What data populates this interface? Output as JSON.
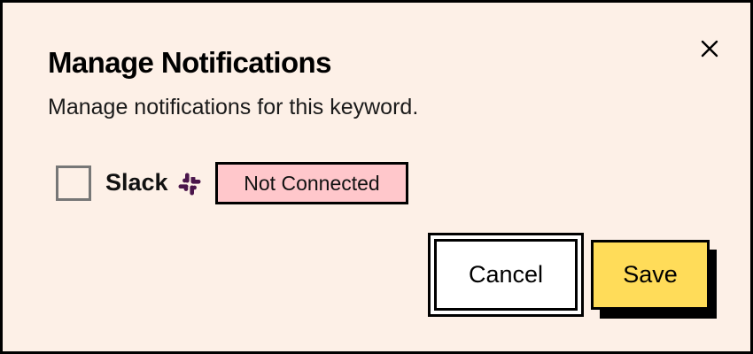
{
  "dialog": {
    "title": "Manage Notifications",
    "subtitle": "Manage notifications for this keyword."
  },
  "integration": {
    "name": "Slack",
    "icon": "slack-logo-icon",
    "checked": false,
    "status": "Not Connected",
    "status_color": "#ffc7cb"
  },
  "actions": {
    "cancel_label": "Cancel",
    "save_label": "Save",
    "save_color": "#ffdc59"
  },
  "colors": {
    "background": "#fdf0e7",
    "slack_icon": "#4a154b"
  }
}
